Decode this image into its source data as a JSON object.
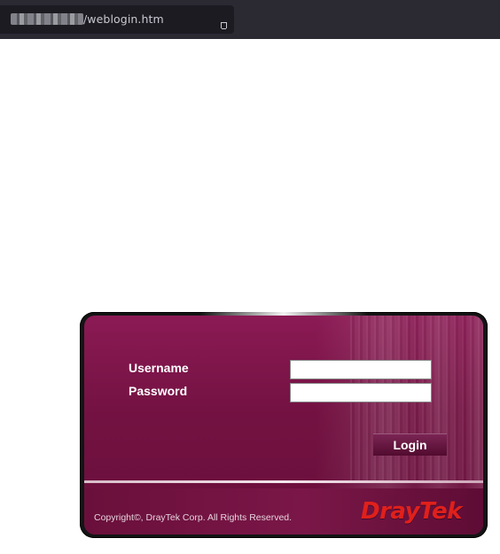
{
  "browser": {
    "url_host_redacted": true,
    "url_path": "/weblogin.htm",
    "bookmark_icon": "bookmark-icon"
  },
  "login": {
    "username_label": "Username",
    "password_label": "Password",
    "username_value": "",
    "password_value": "",
    "login_button": "Login"
  },
  "footer": {
    "copyright": "Copyright©, DrayTek Corp. All Rights Reserved.",
    "logo": "DrayTek"
  },
  "colors": {
    "panel": "#731242",
    "logo": "#e0201b",
    "browser_bar": "#2b2a33"
  }
}
